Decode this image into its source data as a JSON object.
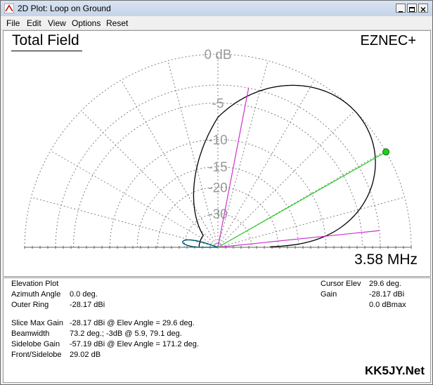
{
  "window": {
    "title": "2D Plot: Loop on Ground",
    "menu": [
      "File",
      "Edit",
      "View",
      "Options",
      "Reset"
    ]
  },
  "plot": {
    "title": "Total Field",
    "brand": "EZNEC+",
    "frequency": "3.58 MHz",
    "ring_labels": [
      "0 dB",
      "-5",
      "-10",
      "-15",
      "-20",
      "-30"
    ]
  },
  "info": {
    "left": [
      {
        "label": "Elevation Plot",
        "value": ""
      },
      {
        "label": "Azimuth Angle",
        "value": "0.0 deg."
      },
      {
        "label": "Outer Ring",
        "value": "-28.17 dBi"
      },
      {
        "label": "Slice Max Gain",
        "value": "-28.17 dBi @ Elev Angle = 29.6 deg."
      },
      {
        "label": "Beamwidth",
        "value": "73.2 deg.; -3dB @ 5.9, 79.1 deg."
      },
      {
        "label": "Sidelobe Gain",
        "value": "-57.19 dBi @ Elev Angle = 171.2 deg."
      },
      {
        "label": "Front/Sidelobe",
        "value": "29.02 dB"
      }
    ],
    "right": [
      {
        "label": "Cursor Elev",
        "value": "29.6 deg."
      },
      {
        "label": "Gain",
        "value": "-28.17 dBi"
      },
      {
        "label": "",
        "value": "0.0 dBmax"
      }
    ],
    "watermark": "KK5JY.Net"
  },
  "chart_data": {
    "type": "polar-elevation",
    "title": "Total Field",
    "max_gain_dbi": -28.17,
    "max_gain_elevation_deg": 29.6,
    "beamwidth_deg": 73.2,
    "minus3db_angles_deg": [
      5.9,
      79.1
    ],
    "sidelobe_gain_dbi": -57.19,
    "sidelobe_elevation_deg": 171.2,
    "front_to_sidelobe_db": 29.02,
    "rings_db": [
      0,
      -3,
      -5,
      -10,
      -15,
      -20,
      -30
    ],
    "colors": {
      "pattern": "#000000",
      "sidelobe": "#1aa3c8",
      "cursor": "#22cc22",
      "beamwidth": "#cc33cc",
      "grid": "#808080"
    }
  }
}
